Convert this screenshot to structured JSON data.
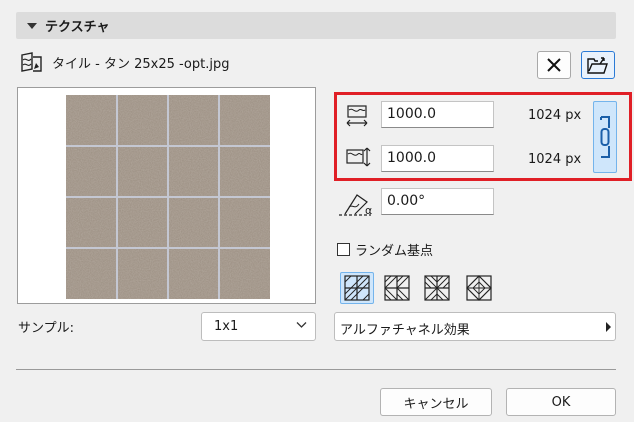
{
  "section": {
    "title": "テクスチャ"
  },
  "file": {
    "name": "タイル - タン 25x25 -opt.jpg",
    "icon": "texture-file-icon"
  },
  "toolbar": {
    "close_icon": "close-icon",
    "export_icon": "export-folder-icon"
  },
  "preview": {
    "grid": "4x4",
    "tile_color": "#9a8d80",
    "grout_color": "#c4c7d2"
  },
  "size": {
    "width": {
      "value": "1000.0",
      "px": "1024 px"
    },
    "height": {
      "value": "1000.0",
      "px": "1024 px"
    },
    "link_icon": "chain-link-icon"
  },
  "angle": {
    "value": "0.00°"
  },
  "random_origin": {
    "label": "ランダム基点",
    "checked": false
  },
  "patterns": [
    {
      "name": "pattern-straight",
      "active": true
    },
    {
      "name": "pattern-herringbone-v",
      "active": false
    },
    {
      "name": "pattern-herringbone-h",
      "active": false
    },
    {
      "name": "pattern-diamond",
      "active": false
    }
  ],
  "sample": {
    "label": "サンプル:",
    "selected": "1x1"
  },
  "alpha": {
    "label": "アルファチャネル効果"
  },
  "buttons": {
    "cancel": "キャンセル",
    "ok": "OK"
  },
  "colors": {
    "highlight_border": "#e01f26",
    "accent": "#2a7ad6",
    "active_bg": "#cfe6fb"
  }
}
